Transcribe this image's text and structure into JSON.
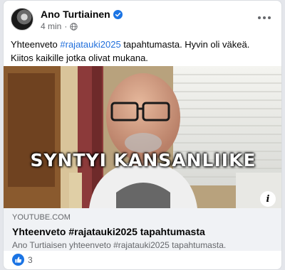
{
  "post": {
    "author": "Ano Turtiainen",
    "time": "4 min",
    "text_before": "Yhteenveto ",
    "hashtag": "#rajatauki2025",
    "text_after": " tapahtumasta. Hyvin oli väkeä. Kiitos kaikille jotka olivat mukana."
  },
  "video": {
    "caption": "SYNTYI KANSANLIIKE"
  },
  "link_preview": {
    "domain": "YOUTUBE.COM",
    "title": "Yhteenveto #rajatauki2025 tapahtumasta",
    "description": "Ano Turtiaisen yhteenveto #rajatauki2025 tapahtumasta."
  },
  "reactions": {
    "count": "3"
  },
  "icons": {
    "verified": "verified-badge-icon",
    "audience": "globe-icon",
    "menu": "more-options-icon",
    "info": "info-icon",
    "like": "like-icon"
  },
  "colors": {
    "hashtag": "#216fdb",
    "like": "#1b74e4",
    "link_box": "#f0f2f5"
  }
}
